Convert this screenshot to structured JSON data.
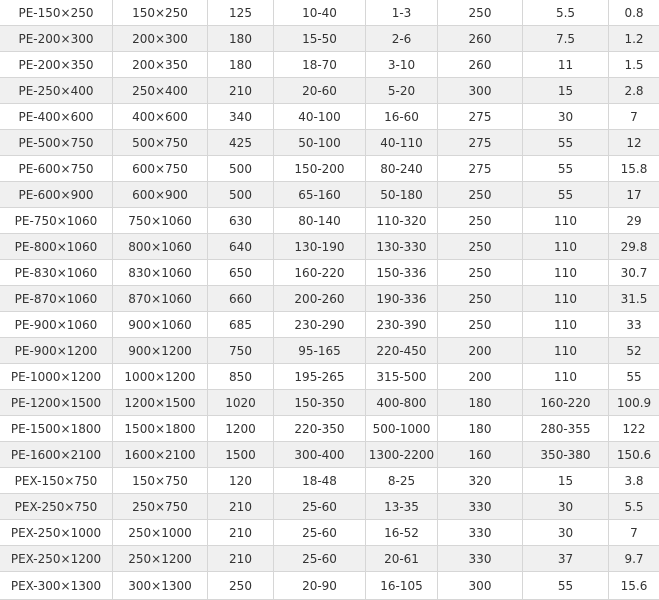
{
  "table": {
    "rows": [
      [
        "PE-150×250",
        "150×250",
        "125",
        "10-40",
        "1-3",
        "250",
        "5.5",
        "0.8"
      ],
      [
        "PE-200×300",
        "200×300",
        "180",
        "15-50",
        "2-6",
        "260",
        "7.5",
        "1.2"
      ],
      [
        "PE-200×350",
        "200×350",
        "180",
        "18-70",
        "3-10",
        "260",
        "11",
        "1.5"
      ],
      [
        "PE-250×400",
        "250×400",
        "210",
        "20-60",
        "5-20",
        "300",
        "15",
        "2.8"
      ],
      [
        "PE-400×600",
        "400×600",
        "340",
        "40-100",
        "16-60",
        "275",
        "30",
        "7"
      ],
      [
        "PE-500×750",
        "500×750",
        "425",
        "50-100",
        "40-110",
        "275",
        "55",
        "12"
      ],
      [
        "PE-600×750",
        "600×750",
        "500",
        "150-200",
        "80-240",
        "275",
        "55",
        "15.8"
      ],
      [
        "PE-600×900",
        "600×900",
        "500",
        "65-160",
        "50-180",
        "250",
        "55",
        "17"
      ],
      [
        "PE-750×1060",
        "750×1060",
        "630",
        "80-140",
        "110-320",
        "250",
        "110",
        "29"
      ],
      [
        "PE-800×1060",
        "800×1060",
        "640",
        "130-190",
        "130-330",
        "250",
        "110",
        "29.8"
      ],
      [
        "PE-830×1060",
        "830×1060",
        "650",
        "160-220",
        "150-336",
        "250",
        "110",
        "30.7"
      ],
      [
        "PE-870×1060",
        "870×1060",
        "660",
        "200-260",
        "190-336",
        "250",
        "110",
        "31.5"
      ],
      [
        "PE-900×1060",
        "900×1060",
        "685",
        "230-290",
        "230-390",
        "250",
        "110",
        "33"
      ],
      [
        "PE-900×1200",
        "900×1200",
        "750",
        "95-165",
        "220-450",
        "200",
        "110",
        "52"
      ],
      [
        "PE-1000×1200",
        "1000×1200",
        "850",
        "195-265",
        "315-500",
        "200",
        "110",
        "55"
      ],
      [
        "PE-1200×1500",
        "1200×1500",
        "1020",
        "150-350",
        "400-800",
        "180",
        "160-220",
        "100.9"
      ],
      [
        "PE-1500×1800",
        "1500×1800",
        "1200",
        "220-350",
        "500-1000",
        "180",
        "280-355",
        "122"
      ],
      [
        "PE-1600×2100",
        "1600×2100",
        "1500",
        "300-400",
        "1300-2200",
        "160",
        "350-380",
        "150.6"
      ],
      [
        "PEX-150×750",
        "150×750",
        "120",
        "18-48",
        "8-25",
        "320",
        "15",
        "3.8"
      ],
      [
        "PEX-250×750",
        "250×750",
        "210",
        "25-60",
        "13-35",
        "330",
        "30",
        "5.5"
      ],
      [
        "PEX-250×1000",
        "250×1000",
        "210",
        "25-60",
        "16-52",
        "330",
        "30",
        "7"
      ],
      [
        "PEX-250×1200",
        "250×1200",
        "210",
        "25-60",
        "20-61",
        "330",
        "37",
        "9.7"
      ],
      [
        "PEX-300×1300",
        "300×1300",
        "250",
        "20-90",
        "16-105",
        "300",
        "55",
        "15.6"
      ]
    ]
  }
}
